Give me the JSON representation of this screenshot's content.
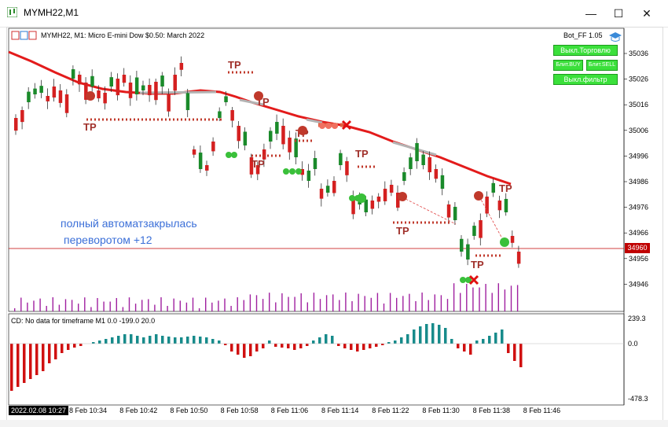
{
  "window": {
    "title": "MYMH22,M1"
  },
  "chart": {
    "symbol_info": "MYMH22, M1:  Micro E-mini Dow $0.50: March 2022",
    "ea_name": "Bot_FF 1.05",
    "current_price": "34960",
    "price_scale": [
      "35036",
      "35026",
      "35016",
      "35006",
      "34996",
      "34986",
      "34976",
      "34966",
      "34956",
      "34946"
    ],
    "time_labels": [
      "8 Feb 10:34",
      "8 Feb 10:42",
      "8 Feb 10:50",
      "8 Feb 10:58",
      "8 Feb 11:06",
      "8 Feb 11:14",
      "8 Feb 11:22",
      "8 Feb 11:30",
      "8 Feb 11:38",
      "8 Feb 11:46"
    ],
    "cursor_time": "2022.02.08 10:27",
    "tp_label": "TP",
    "annotation_line1": "полный автоматзакрылась",
    "annotation_line2": "переворотом +12"
  },
  "buttons": {
    "trade": "Выкл.Торговлю",
    "buy": "Блит.BUY",
    "sell": "Блит.SELL",
    "filter": "Выкл.фильтр"
  },
  "indicator": {
    "label": "CD: No data for timeframe M1 0.0 -199.0 20.0",
    "scale_top": "239.3",
    "scale_zero": "0.0",
    "scale_bottom": "-478.3"
  },
  "colors": {
    "bull": "#1a8a2a",
    "bear": "#d42020",
    "ma": "#e31b1b",
    "ma_flat": "#b3b3b3",
    "hist_pos": "#178b8b",
    "hist_neg": "#d01010",
    "volume": "#a020a0"
  }
}
